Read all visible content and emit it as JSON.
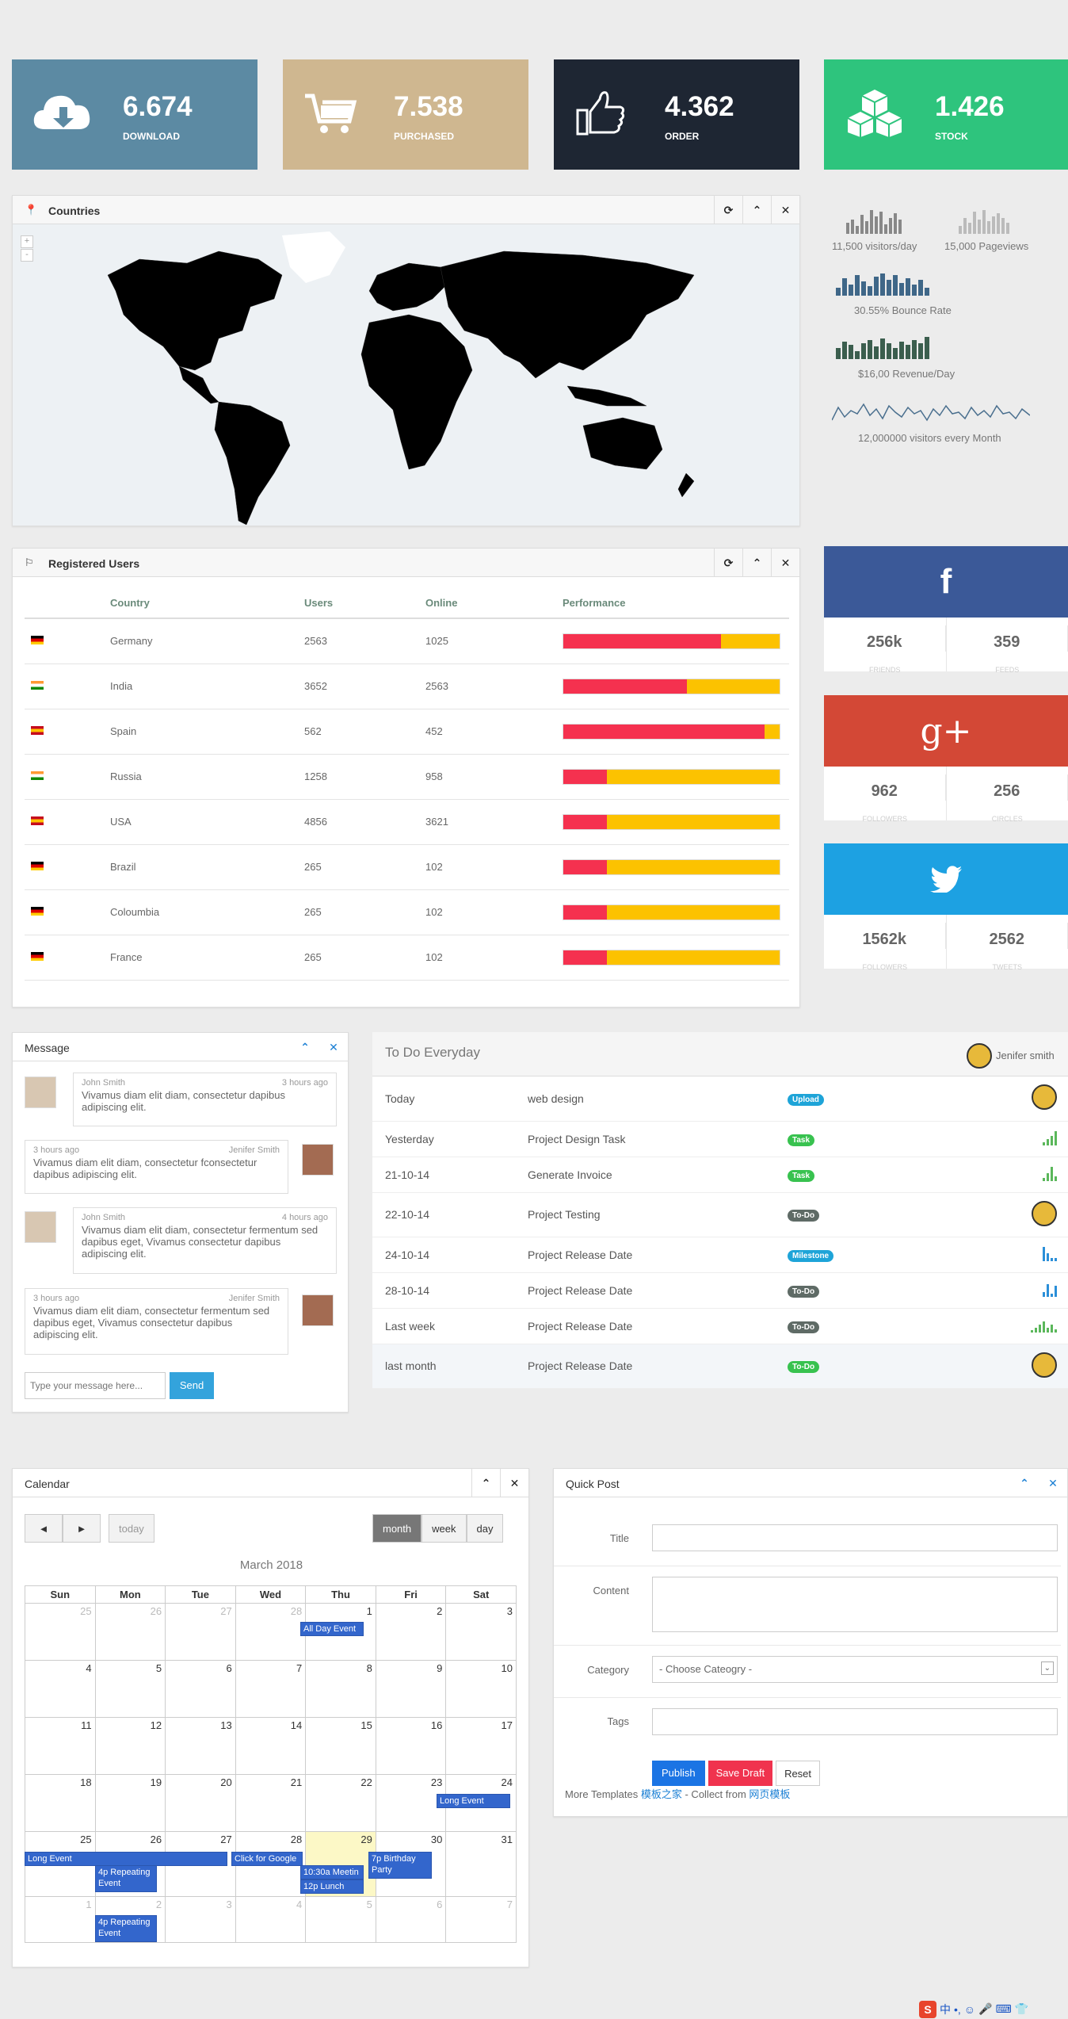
{
  "tiles": [
    {
      "value": "6.674",
      "label": "DOWNLOAD",
      "color": "#5c8aa3",
      "icon": "cloud-download-icon"
    },
    {
      "value": "7.538",
      "label": "PURCHASED",
      "color": "#cfb790",
      "icon": "cart-icon"
    },
    {
      "value": "4.362",
      "label": "ORDER",
      "color": "#1e2633",
      "icon": "thumbs-up-icon"
    },
    {
      "value": "1.426",
      "label": "STOCK",
      "color": "#2ec47d",
      "icon": "cubes-icon"
    }
  ],
  "countries": {
    "title": "Countries",
    "zoom_in": "+",
    "zoom_out": "-"
  },
  "sparks": {
    "visitors": "11,500 visitors/day",
    "pageviews": "15,000 Pageviews",
    "bounce": "30.55% Bounce Rate",
    "revenue": "$16,00 Revenue/Day",
    "month": "12,000000 visitors every Month"
  },
  "users": {
    "title": "Registered Users",
    "headers": [
      "Country",
      "Users",
      "Online",
      "Performance"
    ],
    "rows": [
      {
        "country": "Germany",
        "users": "2563",
        "online": "1025",
        "perf": 0.73,
        "flag": "de"
      },
      {
        "country": "India",
        "users": "3652",
        "online": "2563",
        "perf": 0.57,
        "flag": "in"
      },
      {
        "country": "Spain",
        "users": "562",
        "online": "452",
        "perf": 0.93,
        "flag": "es"
      },
      {
        "country": "Russia",
        "users": "1258",
        "online": "958",
        "perf": 0.2,
        "flag": "in"
      },
      {
        "country": "USA",
        "users": "4856",
        "online": "3621",
        "perf": 0.2,
        "flag": "es"
      },
      {
        "country": "Brazil",
        "users": "265",
        "online": "102",
        "perf": 0.2,
        "flag": "de"
      },
      {
        "country": "Coloumbia",
        "users": "265",
        "online": "102",
        "perf": 0.2,
        "flag": "de"
      },
      {
        "country": "France",
        "users": "265",
        "online": "102",
        "perf": 0.2,
        "flag": "de"
      }
    ]
  },
  "social": [
    {
      "glyph": "f",
      "color": "#3b5998",
      "v1": "256k",
      "k1": "FRIENDS",
      "v2": "359",
      "k2": "FEEDS"
    },
    {
      "glyph": "g+",
      "color": "#d34836",
      "v1": "962",
      "k1": "FOLLOWERS",
      "v2": "256",
      "k2": "CIRCLES"
    },
    {
      "glyph": "t",
      "color": "#1da1e2",
      "v1": "1562k",
      "k1": "FOLLOWERS",
      "v2": "2562",
      "k2": "TWEETS"
    }
  ],
  "message": {
    "title": "Message",
    "placeholder": "Type your message here...",
    "send": "Send",
    "items": [
      {
        "name": "John Smith",
        "time": "3 hours ago",
        "text": "Vivamus diam elit diam, consectetur dapibus adipiscing elit."
      },
      {
        "name": "Jenifer Smith",
        "time": "3 hours ago",
        "text": "Vivamus diam elit diam, consectetur fconsectetur dapibus adipiscing elit."
      },
      {
        "name": "John Smith",
        "time": "4 hours ago",
        "text": "Vivamus diam elit diam, consectetur fermentum sed dapibus eget, Vivamus consectetur dapibus adipiscing elit."
      },
      {
        "name": "Jenifer Smith",
        "time": "3 hours ago",
        "text": "Vivamus diam elit diam, consectetur fermentum sed dapibus eget, Vivamus consectetur dapibus adipiscing elit."
      }
    ]
  },
  "todo": {
    "title": "To Do Everyday",
    "user": "Jenifer smith",
    "rows": [
      {
        "when": "Today",
        "task": "web design",
        "badge": "Upload",
        "bcolor": "#1ea4d8",
        "end": "avatar"
      },
      {
        "when": "Yesterday",
        "task": "Project Design Task",
        "badge": "Task",
        "bcolor": "#38c24f",
        "end": "chart-green"
      },
      {
        "when": "21-10-14",
        "task": "Generate Invoice",
        "badge": "Task",
        "bcolor": "#38c24f",
        "end": "chart-green2"
      },
      {
        "when": "22-10-14",
        "task": "Project Testing",
        "badge": "To-Do",
        "bcolor": "#5f6b66",
        "end": "avatar"
      },
      {
        "when": "24-10-14",
        "task": "Project Release Date",
        "badge": "Milestone",
        "bcolor": "#1ea4d8",
        "end": "chart-blue"
      },
      {
        "when": "28-10-14",
        "task": "Project Release Date",
        "badge": "To-Do",
        "bcolor": "#5f6b66",
        "end": "chart-blue2"
      },
      {
        "when": "Last week",
        "task": "Project Release Date",
        "badge": "To-Do",
        "bcolor": "#5f6b66",
        "end": "chart-green3"
      },
      {
        "when": "last month",
        "task": "Project Release Date",
        "badge": "To-Do",
        "bcolor": "#38c24f",
        "end": "avatar"
      }
    ]
  },
  "calendar": {
    "title": "Calendar",
    "prev": "◄",
    "next": "►",
    "today": "today",
    "month": "month",
    "week": "week",
    "day": "day",
    "heading": "March 2018",
    "days": [
      "Sun",
      "Mon",
      "Tue",
      "Wed",
      "Thu",
      "Fri",
      "Sat"
    ],
    "weeks": [
      [
        "25",
        "26",
        "27",
        "28",
        "1",
        "2",
        "3"
      ],
      [
        "4",
        "5",
        "6",
        "7",
        "8",
        "9",
        "10"
      ],
      [
        "11",
        "12",
        "13",
        "14",
        "15",
        "16",
        "17"
      ],
      [
        "18",
        "19",
        "20",
        "21",
        "22",
        "23",
        "24"
      ],
      [
        "25",
        "26",
        "27",
        "28",
        "29",
        "30",
        "31"
      ],
      [
        "1",
        "2",
        "3",
        "4",
        "5",
        "6",
        "7"
      ]
    ],
    "events": {
      "allday": "All Day Event",
      "long1": "Long Event",
      "long2": "Long Event",
      "rep1": "4p Repeating Event",
      "google": "Click for Google",
      "meet": "10:30a Meetin",
      "lunch": "12p Lunch",
      "bday": "7p Birthday Party",
      "rep2": "4p Repeating Event"
    }
  },
  "quickpost": {
    "title": "Quick Post",
    "title_lbl": "Title",
    "content_lbl": "Content",
    "category_lbl": "Category",
    "category_val": "- Choose Cateogry -",
    "tags_lbl": "Tags",
    "publish": "Publish",
    "draft": "Save Draft",
    "reset": "Reset",
    "more": "More Templates ",
    "link1": "模板之家",
    "mid": " - Collect from ",
    "link2": "网页模板"
  }
}
